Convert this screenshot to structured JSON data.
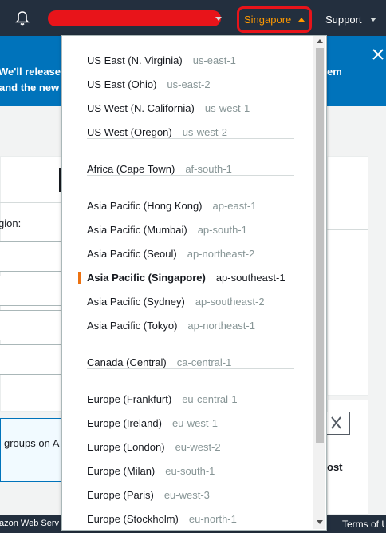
{
  "topnav": {
    "region_label": "Singapore",
    "support_label": "Support"
  },
  "banner": {
    "line1_left": "We'll release n",
    "line1_right": "em",
    "line2_left": "and the new"
  },
  "background": {
    "region_prompt": "gion:",
    "groups_text": "groups on A",
    "ost_text": "ost",
    "footer_left": "azon Web Serv",
    "footer_right": "Terms of U"
  },
  "region_menu": {
    "groups": [
      {
        "items": [
          {
            "name": "US East (N. Virginia)",
            "code": "us-east-1"
          },
          {
            "name": "US East (Ohio)",
            "code": "us-east-2"
          },
          {
            "name": "US West (N. California)",
            "code": "us-west-1"
          },
          {
            "name": "US West (Oregon)",
            "code": "us-west-2"
          }
        ]
      },
      {
        "items": [
          {
            "name": "Africa (Cape Town)",
            "code": "af-south-1"
          }
        ]
      },
      {
        "items": [
          {
            "name": "Asia Pacific (Hong Kong)",
            "code": "ap-east-1"
          },
          {
            "name": "Asia Pacific (Mumbai)",
            "code": "ap-south-1"
          },
          {
            "name": "Asia Pacific (Seoul)",
            "code": "ap-northeast-2"
          },
          {
            "name": "Asia Pacific (Singapore)",
            "code": "ap-southeast-1",
            "selected": true
          },
          {
            "name": "Asia Pacific (Sydney)",
            "code": "ap-southeast-2"
          },
          {
            "name": "Asia Pacific (Tokyo)",
            "code": "ap-northeast-1"
          }
        ]
      },
      {
        "items": [
          {
            "name": "Canada (Central)",
            "code": "ca-central-1"
          }
        ]
      },
      {
        "items": [
          {
            "name": "Europe (Frankfurt)",
            "code": "eu-central-1"
          },
          {
            "name": "Europe (Ireland)",
            "code": "eu-west-1"
          },
          {
            "name": "Europe (London)",
            "code": "eu-west-2"
          },
          {
            "name": "Europe (Milan)",
            "code": "eu-south-1"
          },
          {
            "name": "Europe (Paris)",
            "code": "eu-west-3"
          },
          {
            "name": "Europe (Stockholm)",
            "code": "eu-north-1"
          }
        ]
      }
    ]
  },
  "colors": {
    "nav_bg": "#232f3e",
    "accent": "#ff9900",
    "banner_bg": "#0073bb",
    "highlight_red": "#e8141a",
    "selected_bar": "#ec7211"
  }
}
